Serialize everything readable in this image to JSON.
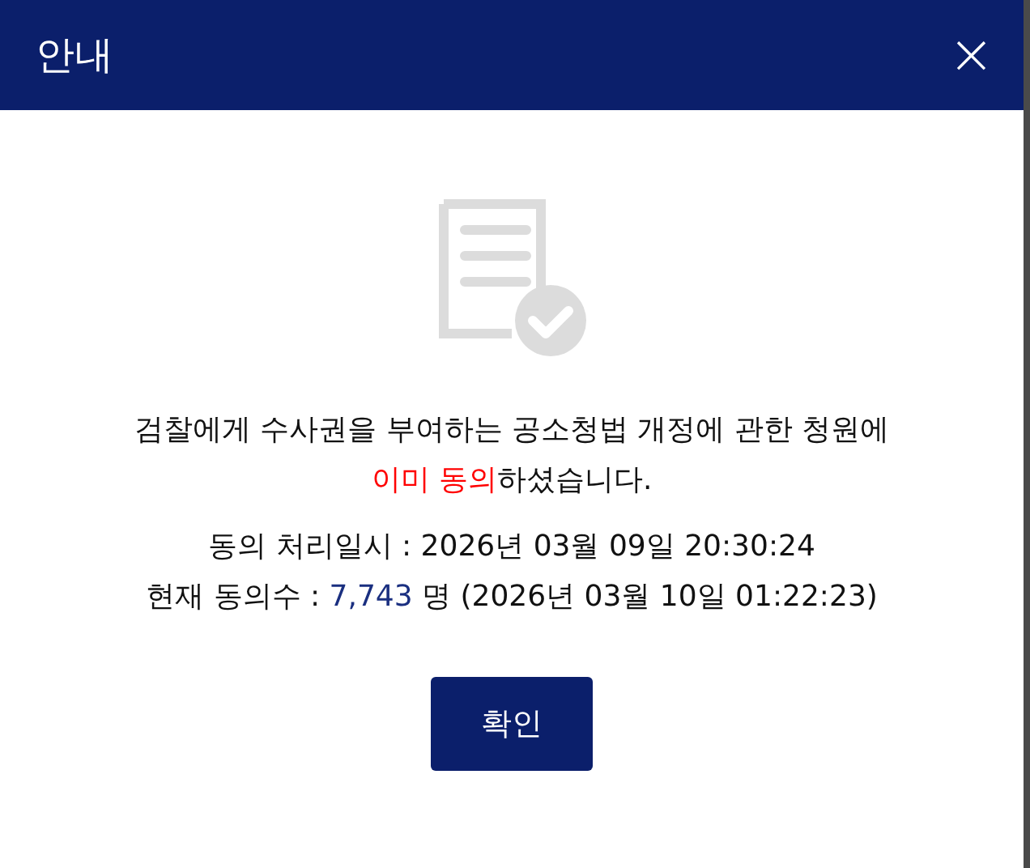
{
  "dialog": {
    "title": "안내",
    "close": "×",
    "message": [
      [
        {
          "text": "검찰에게 수사권을 부여하는 공소청법 개정에 관한 청원에"
        }
      ],
      [
        {
          "text": "이미 동의",
          "color": "#ff0000"
        },
        {
          "text": "하셨습니다."
        }
      ]
    ],
    "details": [
      [
        {
          "text": "동의 처리일시 : 2026년 03월 09일 20:30:24"
        }
      ],
      [
        {
          "text": "현재 동의수 : "
        },
        {
          "text": "7,743",
          "color": "#1a2f80"
        },
        {
          "text": " 명 (2026년 03월 10일 01:22:23)"
        }
      ]
    ],
    "button": "확인"
  }
}
